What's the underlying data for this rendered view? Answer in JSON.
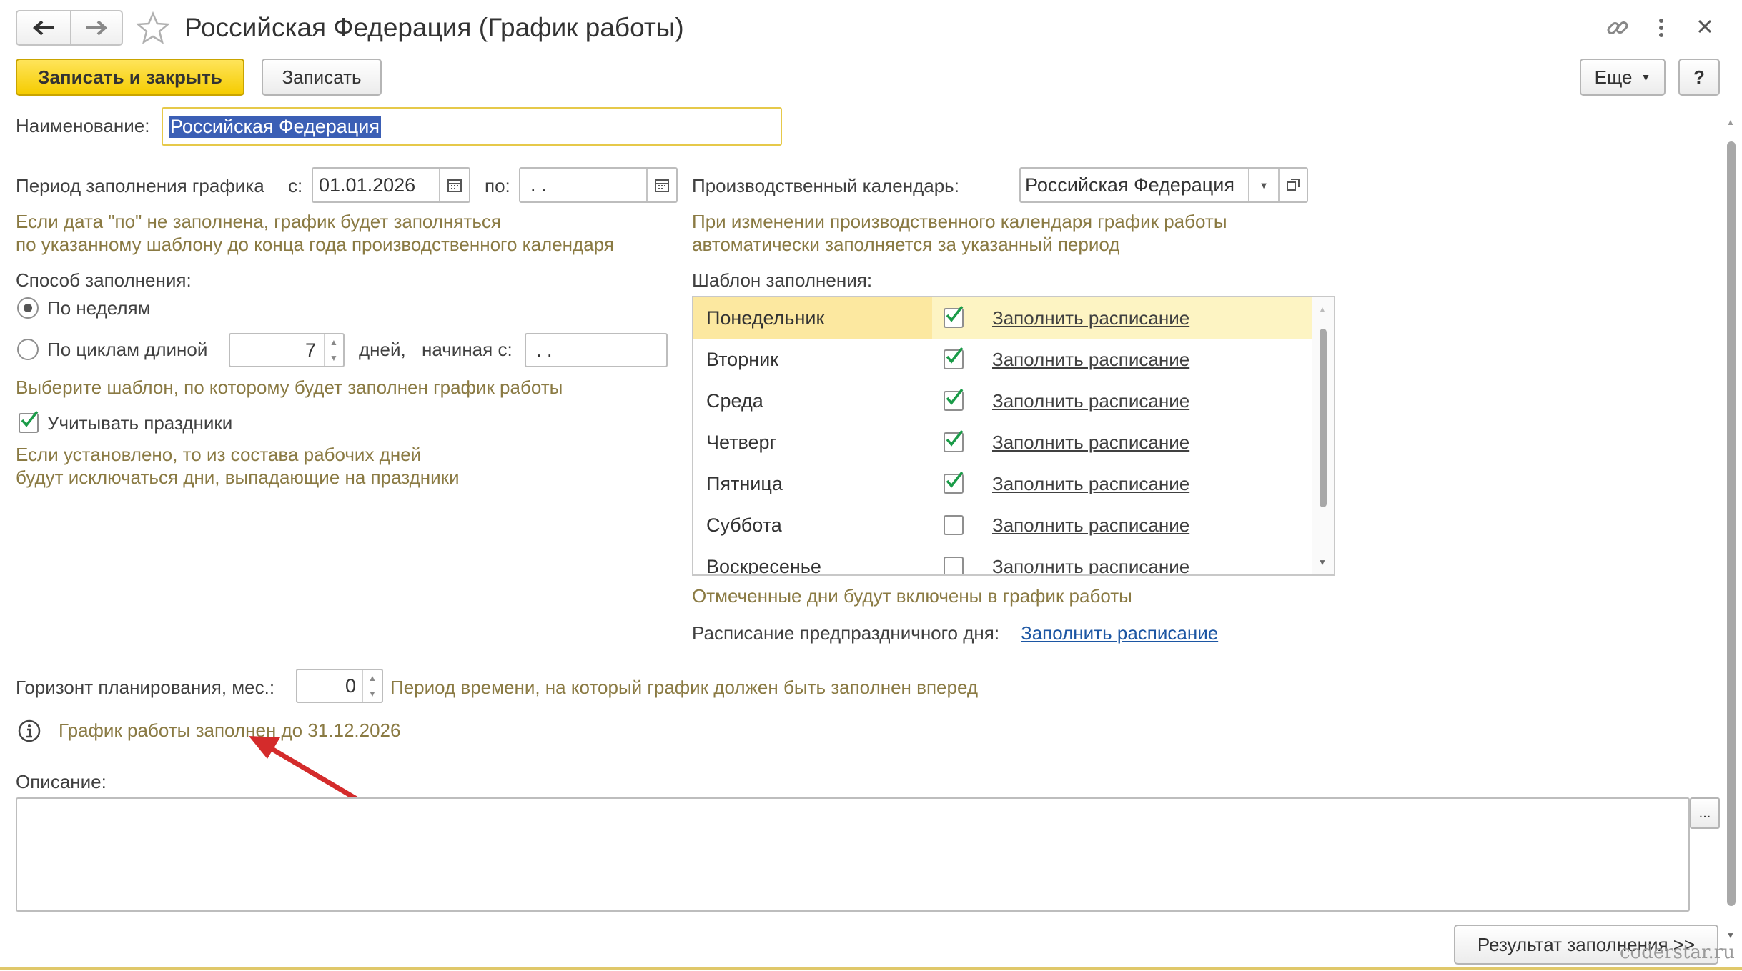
{
  "window": {
    "title": "Российская Федерация (График работы)",
    "nav_back": "back-arrow",
    "nav_forward": "forward-arrow"
  },
  "toolbar": {
    "save_close_label": "Записать и закрыть",
    "save_label": "Записать",
    "more_label": "Еще",
    "help_label": "?"
  },
  "form": {
    "name_label": "Наименование:",
    "name_value": "Российская Федерация",
    "period_label": "Период заполнения графика",
    "period_from_label": "с:",
    "period_from_value": "01.01.2026",
    "period_to_label": "по:",
    "period_to_value": " .  .",
    "period_hint_1": "Если дата \"по\" не заполнена, график будет заполняться",
    "period_hint_2": "по указанному шаблону до конца года производственного календаря",
    "fill_method_label": "Способ заполнения:",
    "by_weeks_label": "По неделям",
    "by_cycles_label": "По циклам длиной",
    "cycle_length": "7",
    "days_label": "дней,",
    "starting_label": "начиная с:",
    "starting_value": " .  .",
    "template_hint": "Выберите шаблон, по которому будет заполнен график работы",
    "holidays_label": "Учитывать праздники",
    "holidays_checked": true,
    "holidays_hint_1": "Если установлено, то из состава рабочих дней",
    "holidays_hint_2": "будут исключаться дни, выпадающие на праздники",
    "calendar_label": "Производственный календарь:",
    "calendar_value": "Российская Федерация",
    "calendar_hint_1": "При изменении производственного календаря график работы",
    "calendar_hint_2": "автоматически заполняется за указанный период",
    "template_label": "Шаблон заполнения:",
    "days": [
      {
        "name": "Понедельник",
        "checked": true,
        "link": "Заполнить расписание"
      },
      {
        "name": "Вторник",
        "checked": true,
        "link": "Заполнить расписание"
      },
      {
        "name": "Среда",
        "checked": true,
        "link": "Заполнить расписание"
      },
      {
        "name": "Четверг",
        "checked": true,
        "link": "Заполнить расписание"
      },
      {
        "name": "Пятница",
        "checked": true,
        "link": "Заполнить расписание"
      },
      {
        "name": "Суббота",
        "checked": false,
        "link": "Заполнить расписание"
      },
      {
        "name": "Воскресенье",
        "checked": false,
        "link": "Заполнить расписание"
      }
    ],
    "days_hint": "Отмеченные дни будут включены в график работы",
    "pre_holiday_label": "Расписание предпраздничного дня:",
    "pre_holiday_link": "Заполнить расписание",
    "horizon_label": "Горизонт планирования, мес.:",
    "horizon_value": "0",
    "horizon_hint": "Период времени, на который график должен быть заполнен вперед",
    "filled_info": "График работы заполнен до 31.12.2026",
    "description_label": "Описание:",
    "description_value": "",
    "description_more": "...",
    "result_button": "Результат заполнения >>"
  },
  "watermark": "coderstar.ru",
  "colors": {
    "primary_button": "#f5cc00",
    "hint_text": "#8a7a43",
    "check_green": "#1a9b48",
    "selected_row": "#fdf4c3",
    "link_blue": "#1c56a3",
    "annotation_arrow": "#d42b2b"
  }
}
